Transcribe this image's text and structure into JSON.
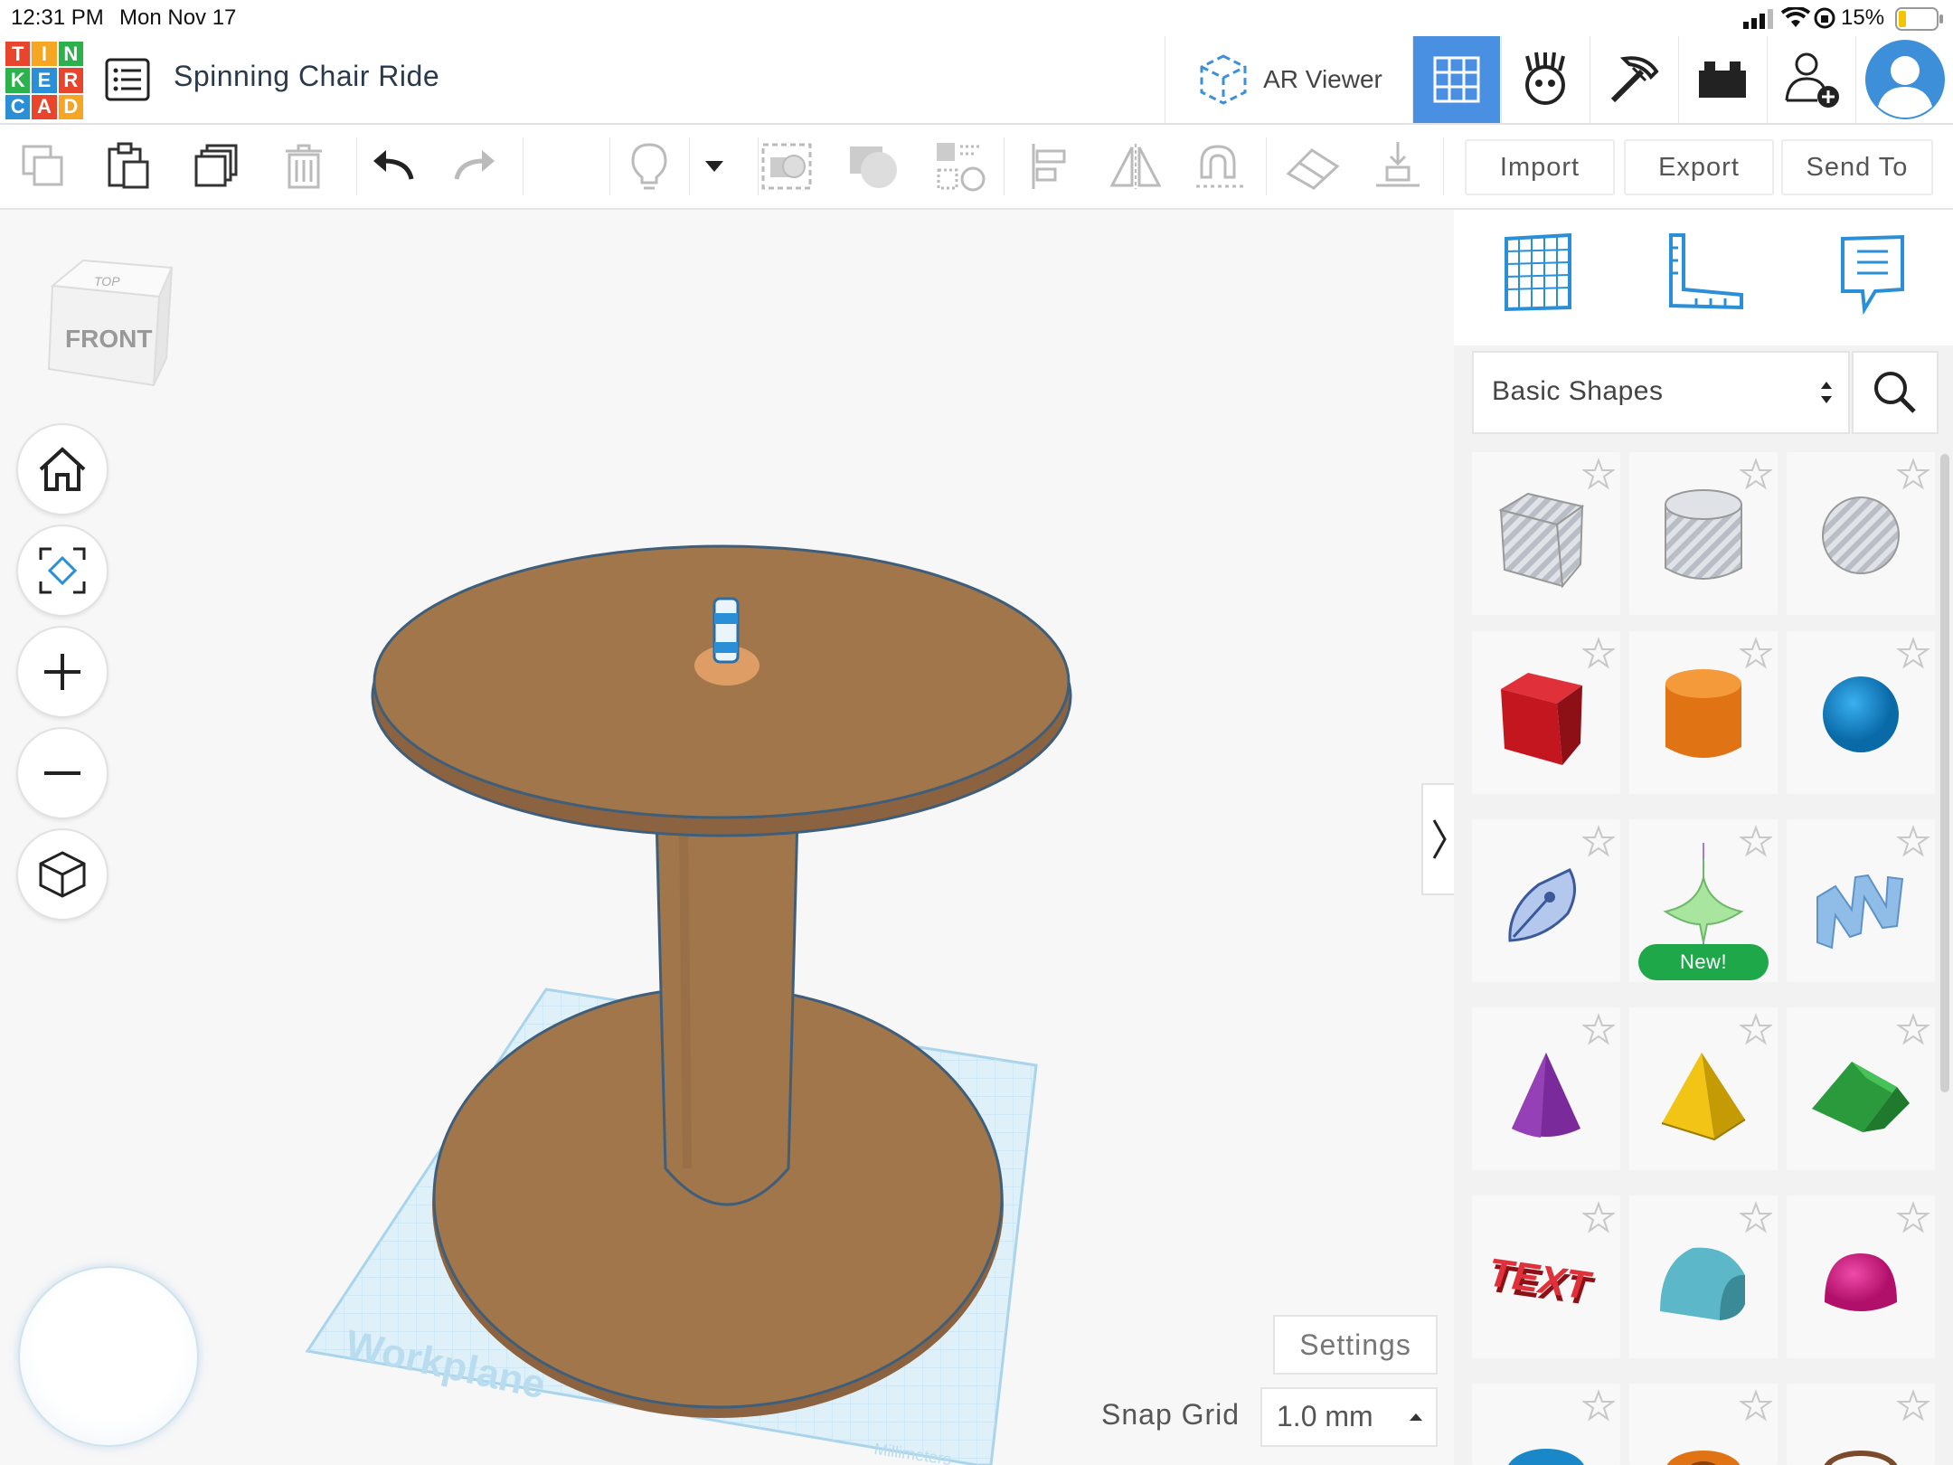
{
  "status_bar": {
    "time": "12:31 PM",
    "date": "Mon Nov 17",
    "battery": "15%"
  },
  "logo": {
    "letters": [
      "T",
      "I",
      "N",
      "K",
      "E",
      "R",
      "C",
      "A",
      "D"
    ],
    "colors": [
      "#e8452c",
      "#f6a623",
      "#2bb24c",
      "#2bb24c",
      "#2a8fd6",
      "#e8452c",
      "#2a8fd6",
      "#e8452c",
      "#f6a623"
    ]
  },
  "project": {
    "title": "Spinning Chair Ride"
  },
  "header": {
    "ar_viewer_label": "AR Viewer"
  },
  "toolbar": {
    "import_label": "Import",
    "export_label": "Export",
    "send_to_label": "Send To"
  },
  "viewcube": {
    "top_label": "TOP",
    "front_label": "FRONT"
  },
  "workplane": {
    "label": "Workplane",
    "units": "Millimeters"
  },
  "canvas": {
    "settings_label": "Settings",
    "snap_grid_label": "Snap Grid",
    "snap_grid_value": "1.0 mm"
  },
  "panel": {
    "category": "Basic Shapes",
    "new_badge": "New!",
    "shapes": [
      {
        "name": "Box (hole)",
        "icon": "box-hole-icon"
      },
      {
        "name": "Cylinder (hole)",
        "icon": "cylinder-hole-icon"
      },
      {
        "name": "Sphere (hole)",
        "icon": "sphere-hole-icon"
      },
      {
        "name": "Box",
        "icon": "box-icon"
      },
      {
        "name": "Cylinder",
        "icon": "cylinder-icon"
      },
      {
        "name": "Sphere",
        "icon": "sphere-icon"
      },
      {
        "name": "Scribble",
        "icon": "scribble-icon"
      },
      {
        "name": "Spinning Top",
        "icon": "spinning-top-icon"
      },
      {
        "name": "Shape Generator",
        "icon": "shape-generator-icon"
      },
      {
        "name": "Cone",
        "icon": "cone-icon"
      },
      {
        "name": "Pyramid",
        "icon": "pyramid-icon"
      },
      {
        "name": "Roof",
        "icon": "roof-icon"
      },
      {
        "name": "Text",
        "icon": "text-icon"
      },
      {
        "name": "Half Cylinder",
        "icon": "half-cylinder-icon"
      },
      {
        "name": "Paraboloid",
        "icon": "paraboloid-icon"
      }
    ],
    "shape_text": "TEXT"
  },
  "colors": {
    "accent": "#3d8fd9",
    "wood": "#a0764a",
    "new_badge": "#1fa84a"
  }
}
